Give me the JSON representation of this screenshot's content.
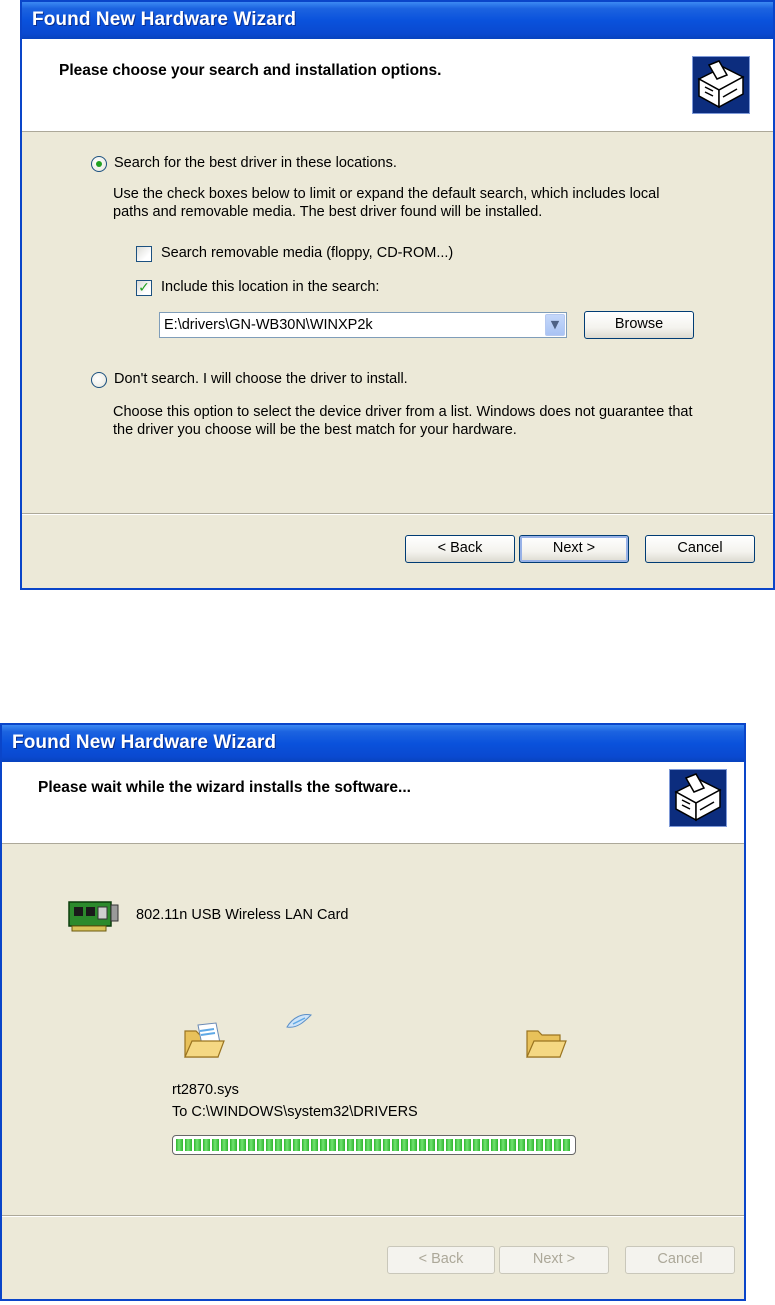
{
  "dialog1": {
    "title": "Found New Hardware Wizard",
    "header": "Please choose your search and installation options.",
    "option_search_label": "Search for the best driver in these locations.",
    "option_search_desc_line1": "Use the check boxes below to limit or expand the default search, which includes local",
    "option_search_desc_line2": "paths and removable media. The best driver found will be installed.",
    "checkbox_removable_label": "Search removable media (floppy, CD-ROM...)",
    "checkbox_removable_checked": false,
    "checkbox_location_label": "Include this location in the search:",
    "checkbox_location_checked": true,
    "location_value": "E:\\drivers\\GN-WB30N\\WINXP2k",
    "browse_label": "Browse",
    "option_manual_label": "Don't search. I will choose the driver to install.",
    "option_manual_desc_line1": "Choose this option to select the device driver from a list.  Windows does not guarantee that",
    "option_manual_desc_line2": "the driver you choose will be the best match for your hardware.",
    "selected_option": "search",
    "back_label": "< Back",
    "next_label": "Next >",
    "cancel_label": "Cancel",
    "icons": [
      "hardware-wizard-icon",
      "radio",
      "checkbox",
      "dropdown-arrow"
    ]
  },
  "dialog2": {
    "title": "Found New Hardware Wizard",
    "header": "Please wait while the wizard installs the software...",
    "device_name": "802.11n USB Wireless LAN Card",
    "file_name": "rt2870.sys",
    "destination": "To C:\\WINDOWS\\system32\\DRIVERS",
    "progress": 1.0,
    "back_label": "< Back",
    "next_label": "Next >",
    "cancel_label": "Cancel",
    "buttons_disabled": true,
    "icons": [
      "hardware-wizard-icon",
      "network-card-icon",
      "source-folder-icon",
      "flying-paper-icon",
      "destination-folder-icon"
    ]
  },
  "colors": {
    "titlebar": "#0a52dc",
    "dialog_bg": "#ece9d8",
    "check_green": "#21a121",
    "progress_green": "#2fb52f"
  }
}
